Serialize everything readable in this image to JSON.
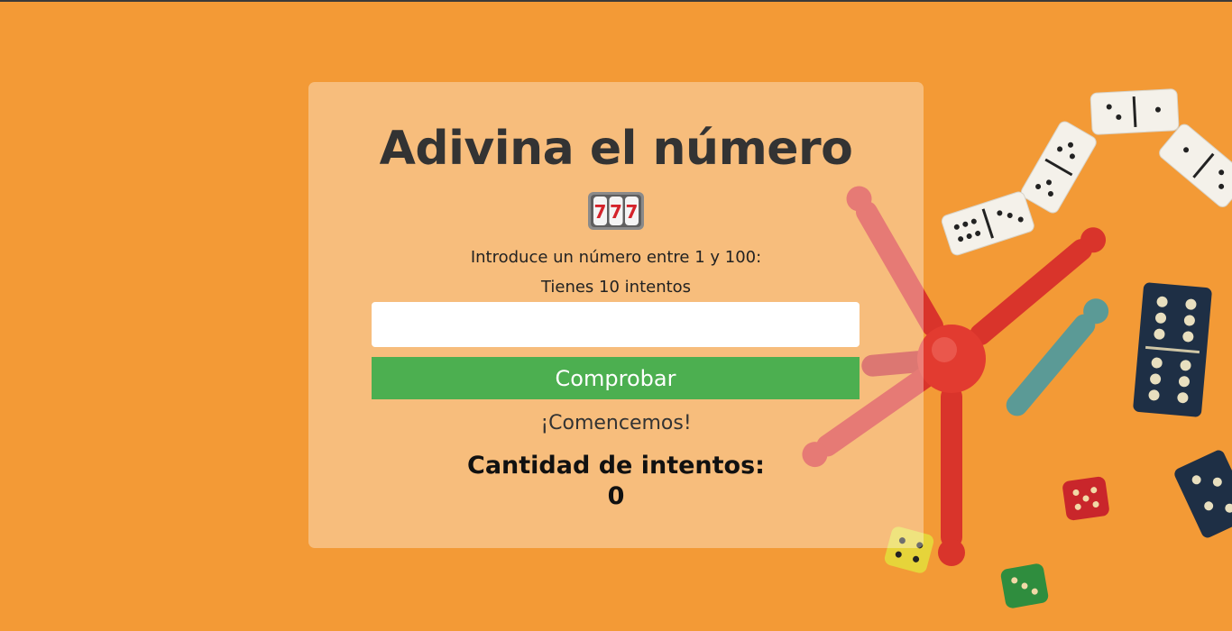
{
  "game": {
    "title": "Adivina el número",
    "icon": "slot-machine-777-icon",
    "instruction": "Introduce un número entre 1 y 100:",
    "attempts_info": "Tienes 10 intentos",
    "input": {
      "value": "",
      "placeholder": ""
    },
    "check_button_label": "Comprobar",
    "message": "¡Comencemos!",
    "counter_label": "Cantidad de intentos:",
    "counter_value": "0"
  },
  "background": {
    "description_icons": [
      "domino-icon",
      "pawn-icon",
      "dice-icon"
    ]
  },
  "colors": {
    "background": "#f39a36",
    "button": "#4caf50",
    "title": "#333333"
  }
}
